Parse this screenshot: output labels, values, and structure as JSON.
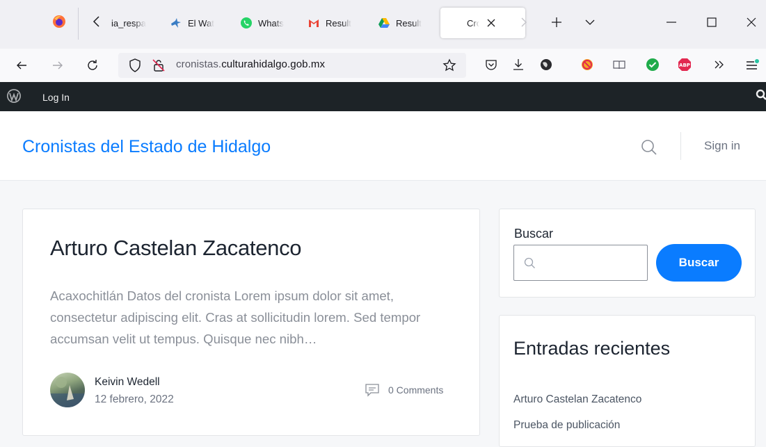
{
  "browser": {
    "tabs": [
      {
        "label": "ia_respa"
      },
      {
        "label": "El Wat"
      },
      {
        "label": "Whats"
      },
      {
        "label": "Result"
      },
      {
        "label": "Result"
      }
    ],
    "active_tab": {
      "label": "Cro"
    },
    "url_prefix": "cronistas.",
    "url_domain": "culturahidalgo.gob.mx"
  },
  "admin_bar": {
    "login": "Log In"
  },
  "header": {
    "site_title": "Cronistas del Estado de Hidalgo",
    "sign_in": "Sign in"
  },
  "post": {
    "title": "Arturo Castelan Zacatenco",
    "excerpt": "Acaxochitlán Datos del cronista Lorem ipsum dolor sit amet, consectetur adipiscing elit. Cras at sollicitudin lorem. Sed tempor accumsan velit ut tempus. Quisque nec nibh…",
    "author": "Keivin Wedell",
    "date": "12 febrero, 2022",
    "comments": "0 Comments"
  },
  "sidebar": {
    "search_label": "Buscar",
    "search_placeholder": "",
    "search_button": "Buscar",
    "recent_title": "Entradas recientes",
    "recent_items": [
      "Arturo Castelan Zacatenco",
      "Prueba de publicación"
    ]
  },
  "colors": {
    "accent": "#0a7cff",
    "admin_bar": "#1d2327"
  }
}
